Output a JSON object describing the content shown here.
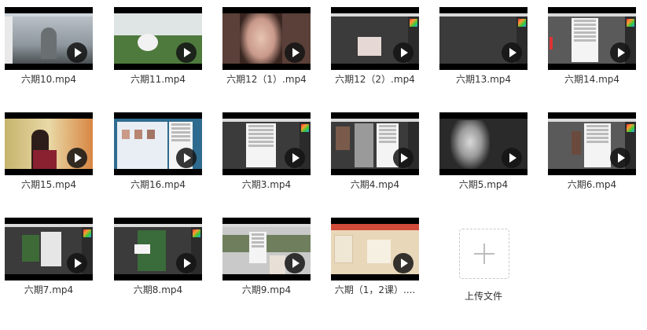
{
  "files": [
    {
      "name": "六期10.mp4",
      "icon": "play-icon"
    },
    {
      "name": "六期11.mp4",
      "icon": "play-icon"
    },
    {
      "name": "六期12（1）.mp4",
      "icon": "play-icon"
    },
    {
      "name": "六期12（2）.mp4",
      "icon": "play-icon"
    },
    {
      "name": "六期13.mp4",
      "icon": "play-icon"
    },
    {
      "name": "六期14.mp4",
      "icon": "play-icon"
    },
    {
      "name": "六期15.mp4",
      "icon": "play-icon"
    },
    {
      "name": "六期16.mp4",
      "icon": "play-icon"
    },
    {
      "name": "六期3.mp4",
      "icon": "play-icon"
    },
    {
      "name": "六期4.mp4",
      "icon": "play-icon"
    },
    {
      "name": "六期5.mp4",
      "icon": "play-icon"
    },
    {
      "name": "六期6.mp4",
      "icon": "play-icon"
    },
    {
      "name": "六期7.mp4",
      "icon": "play-icon"
    },
    {
      "name": "六期8.mp4",
      "icon": "play-icon"
    },
    {
      "name": "六期9.mp4",
      "icon": "play-icon"
    },
    {
      "name": "六期（1，2课）....",
      "icon": "play-icon"
    }
  ],
  "upload": {
    "label": "上传文件",
    "icon": "plus-icon"
  },
  "colors": {
    "text": "#333333",
    "thumb_bg": "#000000",
    "upload_border": "#c8c8c8"
  }
}
